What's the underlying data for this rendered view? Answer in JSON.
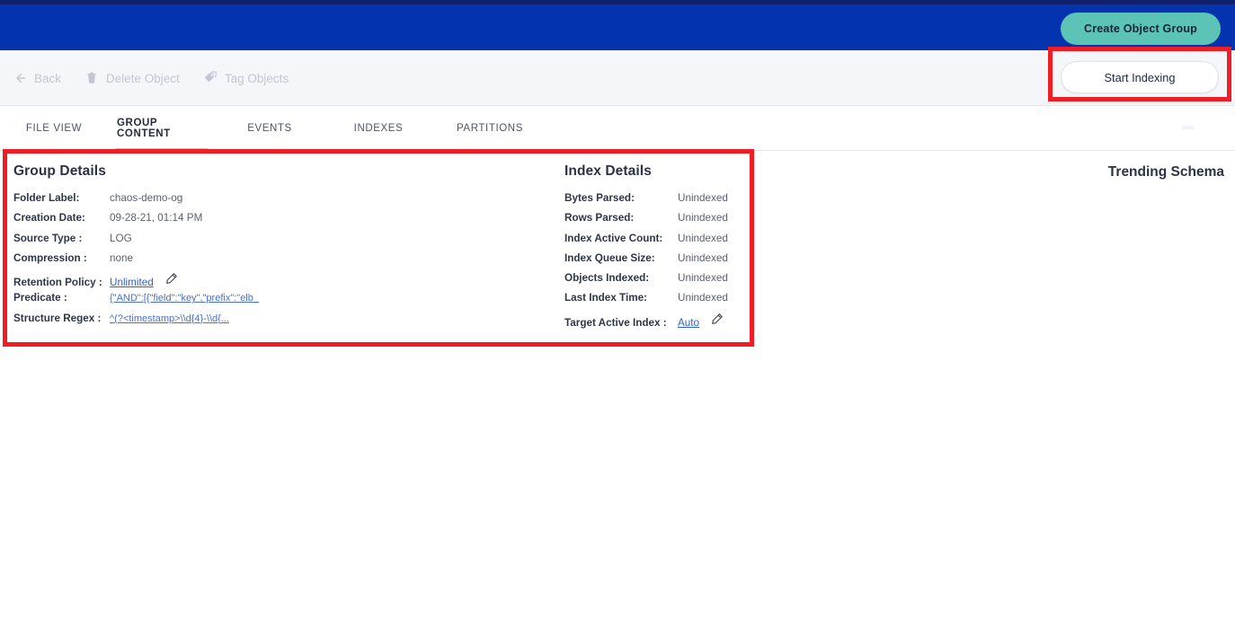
{
  "header": {
    "create_group_label": "Create Object Group",
    "bar_color": "#0433b0",
    "accent_color": "#5cc4b6",
    "top_strip_color": "#12216d"
  },
  "toolbar": {
    "back_label": "Back",
    "delete_object_label": "Delete Object",
    "tag_objects_label": "Tag Objects",
    "start_indexing_label": "Start Indexing"
  },
  "tabs": [
    {
      "label": "FILE VIEW",
      "active": false
    },
    {
      "label": "GROUP CONTENT",
      "active": true
    },
    {
      "label": "EVENTS",
      "active": false
    },
    {
      "label": "INDEXES",
      "active": false
    },
    {
      "label": "PARTITIONS",
      "active": false
    }
  ],
  "group_details": {
    "title": "Group Details",
    "rows": [
      {
        "key": "Folder Label:",
        "value": "chaos-demo-og"
      },
      {
        "key": "Creation Date:",
        "value": "09-28-21, 01:14 PM"
      },
      {
        "key": "Source Type :",
        "value": "LOG"
      },
      {
        "key": "Compression :",
        "value": "none"
      },
      {
        "key": "Retention Policy :",
        "value": "Unlimited"
      },
      {
        "key": "Predicate :",
        "value": "{\"AND\":[{\"field\":\"key\",\"prefix\":\"elb_"
      },
      {
        "key": "Structure Regex :",
        "value": "^(?<timestamp>\\\\d{4}-\\\\d{..."
      }
    ]
  },
  "index_details": {
    "title": "Index Details",
    "rows": [
      {
        "key": "Bytes Parsed:",
        "value": "Unindexed"
      },
      {
        "key": "Rows Parsed:",
        "value": "Unindexed"
      },
      {
        "key": "Index Active Count:",
        "value": "Unindexed"
      },
      {
        "key": "Index Queue Size:",
        "value": "Unindexed"
      },
      {
        "key": "Objects Indexed:",
        "value": "Unindexed"
      },
      {
        "key": "Last Index Time:",
        "value": "Unindexed"
      },
      {
        "key": "Target Active Index :",
        "value": "Auto"
      }
    ]
  },
  "trending_schema": {
    "title": "Trending Schema"
  },
  "annotations": {
    "color": "#ef1d25"
  }
}
